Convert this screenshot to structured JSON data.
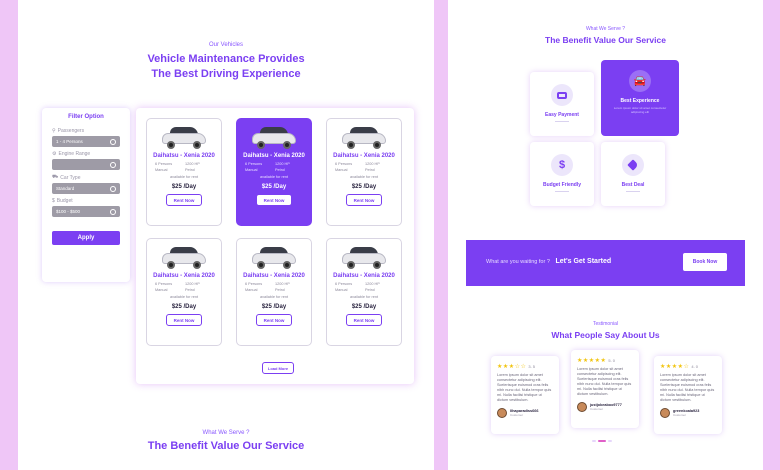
{
  "left": {
    "kicker": "Our Vehicles",
    "title_line1": "Vehicle Maintenance Provides",
    "title_line2": "The Best Driving Experience",
    "filter": {
      "title": "Filter Option",
      "fields": [
        {
          "label": "Passengers",
          "value": "1 - 4 Persons"
        },
        {
          "label": "Engine Range",
          "value": ""
        },
        {
          "label": "Car Type",
          "value": "Standard"
        },
        {
          "label": "Budget",
          "value": "$100 - $500"
        }
      ],
      "apply_label": "Apply"
    },
    "cars": [
      {
        "name": "Daihatsu - Xenia 2020",
        "persons": "6 Persons",
        "cc": "1200 HP",
        "trans": "Manual",
        "fuel": "Petrol",
        "avail": "available for rent",
        "price": "$25 /Day",
        "button": "Rent Now"
      },
      {
        "name": "Daihatsu - Xenia 2020",
        "persons": "6 Persons",
        "cc": "1200 HP",
        "trans": "Manual",
        "fuel": "Petrol",
        "avail": "available for rent",
        "price": "$25 /Day",
        "button": "Rent Now"
      },
      {
        "name": "Daihatsu - Xenia 2020",
        "persons": "6 Persons",
        "cc": "1200 HP",
        "trans": "Manual",
        "fuel": "Petrol",
        "avail": "available for rent",
        "price": "$25 /Day",
        "button": "Rent Now"
      },
      {
        "name": "Daihatsu - Xenia 2020",
        "persons": "6 Persons",
        "cc": "1200 HP",
        "trans": "Manual",
        "fuel": "Petrol",
        "avail": "available for rent",
        "price": "$25 /Day",
        "button": "Rent Now"
      },
      {
        "name": "Daihatsu - Xenia 2020",
        "persons": "6 Persons",
        "cc": "1200 HP",
        "trans": "Manual",
        "fuel": "Petrol",
        "avail": "available for rent",
        "price": "$25 /Day",
        "button": "Rent Now"
      },
      {
        "name": "Daihatsu - Xenia 2020",
        "persons": "6 Persons",
        "cc": "1200 HP",
        "trans": "Manual",
        "fuel": "Petrol",
        "avail": "available for rent",
        "price": "$25 /Day",
        "button": "Rent Now"
      }
    ],
    "load_more": "Load More",
    "bottom_kicker": "What We Serve ?",
    "bottom_title": "The Benefit Value Our Service"
  },
  "right": {
    "kicker": "What We Serve ?",
    "title": "The Benefit Value Our Service",
    "benefits": [
      {
        "title": "Easy Payment",
        "desc": "Lorem ipsum dolor sit amet consectetur adipiscing elit",
        "icon": "wallet-icon"
      },
      {
        "title": "Best Experience",
        "desc": "Lorem ipsum dolor sit amet consectetur adipiscing elit",
        "icon": "car-icon"
      },
      {
        "title": "Budget Friendly",
        "desc": "Lorem ipsum dolor sit amet",
        "icon": "dollar-icon"
      },
      {
        "title": "Best Deal",
        "desc": "Lorem ipsum dolor sit amet",
        "icon": "tag-icon"
      }
    ],
    "cta": {
      "text": "What are you waiting for ?",
      "strong": "Let's Get Started",
      "button": "Book Now"
    },
    "test_kicker": "Testimonial",
    "test_title": "What People Say About Us",
    "testimonials": [
      {
        "stars": "★★★☆☆",
        "rating": "3.5",
        "text": "Lorem ipsum dolor sit amet consectetur adipiscing elit. Scelerisque euismod cras felis nibh nunc dui. Nulla tempor quis mi. Nulla facilisi tristique ut dictum vestibulum.",
        "name": "Ilhaparadiss666",
        "role": "Customer"
      },
      {
        "stars": "★★★★★",
        "rating": "5.0",
        "text": "Lorem ipsum dolor sit amet consectetur adipiscing elit. Scelerisque euismod cras felis nibh nunc dui. Nulla tempor quis mi. Nulla facilisi tristique ut dictum vestibulum.",
        "name": "justjokeaboo9777",
        "role": "Customer"
      },
      {
        "stars": "★★★★☆",
        "rating": "4.0",
        "text": "Lorem ipsum dolor sit amet consectetur adipiscing elit. Scelerisque euismod cras felis nibh nunc dui. Nulla tempor quis mi. Nulla facilisi tristique ut dictum vestibulum.",
        "name": "greenkoala923",
        "role": "Customer"
      }
    ]
  },
  "colors": {
    "accent": "#7b3ff2",
    "background": "#efc6f7",
    "star": "#f1c40f"
  }
}
